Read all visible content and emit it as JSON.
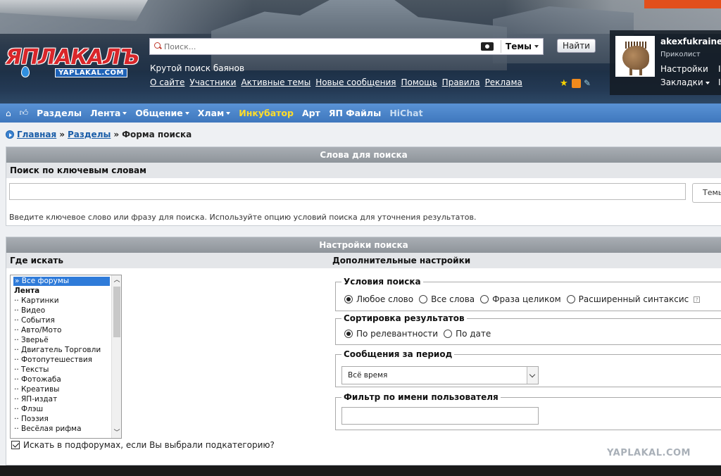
{
  "header": {
    "logo_main": "ЯПЛАКАЛЪ",
    "logo_sub": "YAPLAKAL.COM",
    "search_placeholder": "Поиск...",
    "search_scope": "Темы",
    "search_button": "Найти",
    "tagline": "Крутой поиск баянов",
    "links": [
      "О сайте",
      "Участники",
      "Активные темы",
      "Новые сообщения",
      "Помощь",
      "Правила",
      "Реклама"
    ]
  },
  "user": {
    "name": "akexfukraine",
    "rank": "Приколист",
    "settings": "Настройки",
    "bookmarks": "Закладки",
    "extra1": "I",
    "extra2": "I"
  },
  "nav": {
    "home_icon": "home-icon",
    "like_icon": "thumbs-up-icon",
    "items": [
      {
        "label": "Разделы",
        "dropdown": false,
        "color": "white"
      },
      {
        "label": "Лента",
        "dropdown": true,
        "color": "white"
      },
      {
        "label": "Общение",
        "dropdown": true,
        "color": "white"
      },
      {
        "label": "Хлам",
        "dropdown": true,
        "color": "white"
      },
      {
        "label": "Инкубатор",
        "dropdown": false,
        "color": "#ffdd2a"
      },
      {
        "label": "Арт",
        "dropdown": false,
        "color": "white"
      },
      {
        "label": "ЯП Файлы",
        "dropdown": false,
        "color": "white"
      },
      {
        "label": "HiChat",
        "dropdown": false,
        "color": "#c9ddf2"
      }
    ]
  },
  "breadcrumb": {
    "home": "Главная",
    "sep": "»",
    "sections": "Разделы",
    "current": "Форма поиска"
  },
  "keywords_panel": {
    "title": "Слова для поиска",
    "subhead": "Поиск по ключевым словам",
    "input_value": "",
    "side_button": "Темы",
    "hint": "Введите ключевое слово или фразу для поиска. Используйте опцию условий поиска для уточнения результатов."
  },
  "settings_panel": {
    "title": "Настройки поиска",
    "where_label": "Где искать",
    "extra_label": "Дополнительные настройки",
    "forums": [
      {
        "label": "» Все форумы",
        "selected": true,
        "bold": false
      },
      {
        "label": "Лента",
        "selected": false,
        "bold": true
      },
      {
        "label": "·· Картинки",
        "selected": false,
        "bold": false
      },
      {
        "label": "·· Видео",
        "selected": false,
        "bold": false
      },
      {
        "label": "·· События",
        "selected": false,
        "bold": false
      },
      {
        "label": "·· Авто/Мото",
        "selected": false,
        "bold": false
      },
      {
        "label": "·· Зверьё",
        "selected": false,
        "bold": false
      },
      {
        "label": "·· Двигатель Торговли",
        "selected": false,
        "bold": false
      },
      {
        "label": "·· Фотопутешествия",
        "selected": false,
        "bold": false
      },
      {
        "label": "·· Тексты",
        "selected": false,
        "bold": false
      },
      {
        "label": "·· Фотожаба",
        "selected": false,
        "bold": false
      },
      {
        "label": "·· Креативы",
        "selected": false,
        "bold": false
      },
      {
        "label": "·· ЯП-издат",
        "selected": false,
        "bold": false
      },
      {
        "label": "·· Флэш",
        "selected": false,
        "bold": false
      },
      {
        "label": "·· Поэзия",
        "selected": false,
        "bold": false
      },
      {
        "label": "·· Весёлая рифма",
        "selected": false,
        "bold": false
      }
    ],
    "subforums_checkbox": "Искать в подфорумах, если Вы выбрали подкатегорию?",
    "subforums_checked": true,
    "conditions": {
      "legend": "Условия поиска",
      "options": [
        "Любое слово",
        "Все слова",
        "Фраза целиком",
        "Расширенный синтаксис"
      ],
      "selected": 0
    },
    "sorting": {
      "legend": "Сортировка результатов",
      "options": [
        "По релевантности",
        "По дате"
      ],
      "selected": 0
    },
    "period": {
      "legend": "Сообщения за период",
      "value": "Всё время"
    },
    "user_filter": {
      "legend": "Фильтр по имени пользователя",
      "value": ""
    }
  },
  "watermark": "YAPLAKAL.COM"
}
